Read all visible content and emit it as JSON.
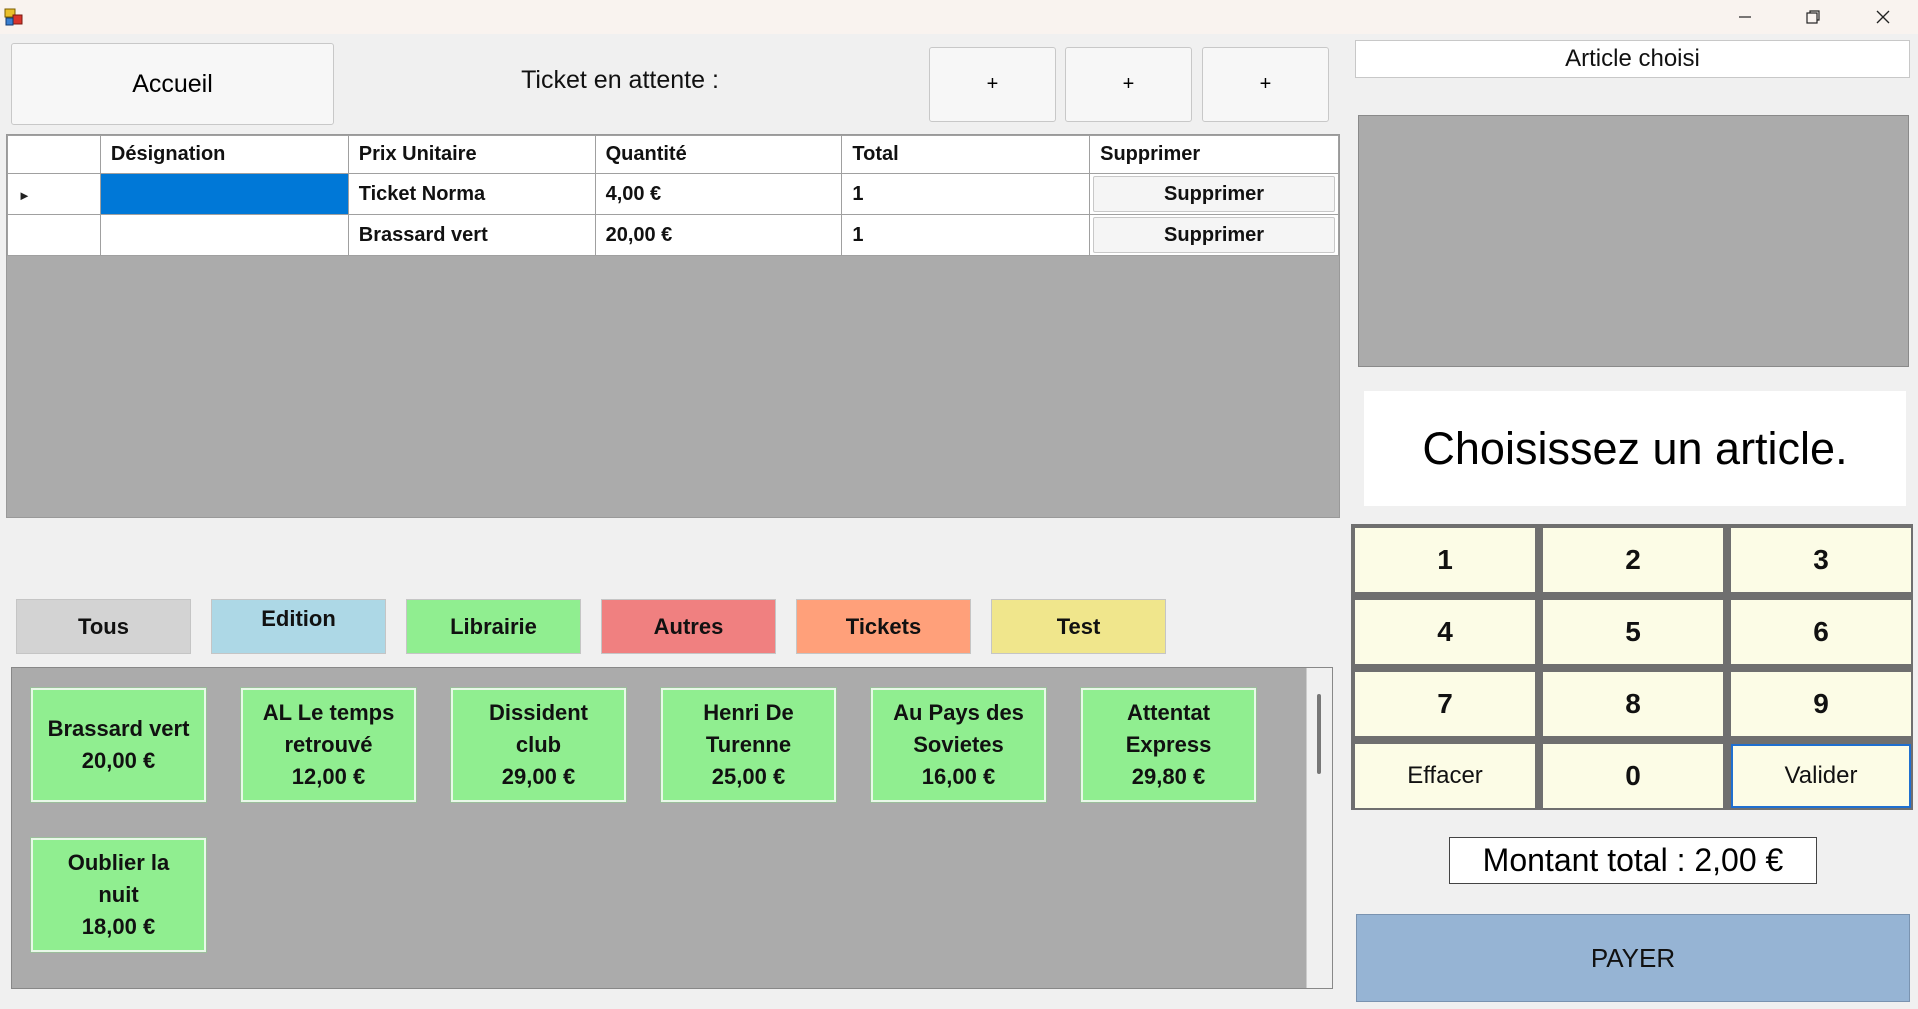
{
  "window": {
    "icons": {
      "app": "app-icon",
      "minimize": "minimize-icon",
      "restore": "restore-icon",
      "close": "close-icon"
    }
  },
  "top": {
    "home_label": "Accueil",
    "ticket_label": "Ticket en attente :",
    "plus_buttons": [
      "+",
      "+",
      "+"
    ]
  },
  "grid": {
    "headers": [
      "",
      "Désignation",
      "Prix Unitaire",
      "Quantité",
      "Total",
      "Supprimer"
    ],
    "rows": [
      {
        "designation": "",
        "prix": "Ticket Norma",
        "quantite": "4,00 €",
        "total": "1",
        "action": "Supprimer"
      },
      {
        "designation": "",
        "prix": "Brassard vert",
        "quantite": "20,00 €",
        "total": "1",
        "action": "Supprimer"
      }
    ]
  },
  "categories": [
    {
      "label": "Tous",
      "color": "#d3d3d3"
    },
    {
      "label": "Edition",
      "color": "#add8e6"
    },
    {
      "label": "Librairie",
      "color": "#90ee90"
    },
    {
      "label": "Autres",
      "color": "#f08080"
    },
    {
      "label": "Tickets",
      "color": "#ffa07a"
    },
    {
      "label": "Test",
      "color": "#f0e68c"
    }
  ],
  "products": [
    {
      "name": "Brassard vert",
      "price": "20,00 €"
    },
    {
      "name": "AL Le temps\nretrouvé",
      "price": "12,00 €"
    },
    {
      "name": "Dissident\nclub",
      "price": "29,00 €"
    },
    {
      "name": "Henri De\nTurenne",
      "price": "25,00 €"
    },
    {
      "name": "Au Pays des\nSovietes",
      "price": "16,00 €"
    },
    {
      "name": "Attentat\nExpress",
      "price": "29,80 €"
    },
    {
      "name": "Oublier la\nnuit",
      "price": "18,00 €"
    }
  ],
  "right": {
    "article_title": "Article choisi",
    "message": "Choisissez un article.",
    "keys": [
      "1",
      "2",
      "3",
      "4",
      "5",
      "6",
      "7",
      "8",
      "9",
      "Effacer",
      "0",
      "Valider"
    ],
    "total": "Montant total : 2,00 €",
    "pay_label": "PAYER"
  },
  "colors": {
    "selection": "#0078d7",
    "product_bg": "#90ee90",
    "pay_bg": "#96b4d4",
    "key_bg": "#fcfce6"
  }
}
